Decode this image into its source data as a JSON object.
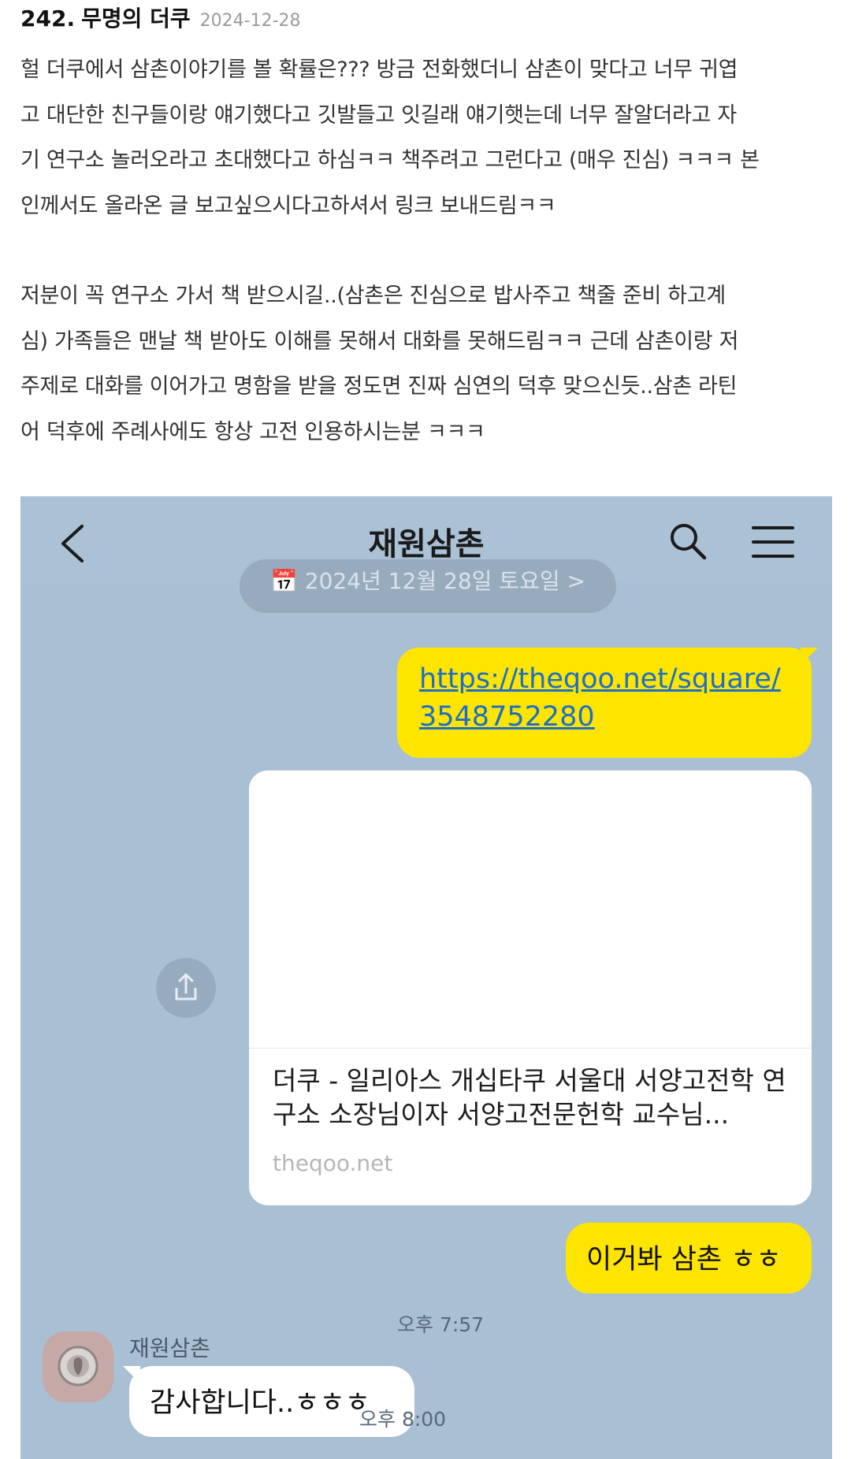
{
  "post": {
    "number": "242.",
    "author": "무명의 더쿠",
    "date": "2024-12-28",
    "paragraphs": [
      "헐 더쿠에서 삼촌이야기를 볼 확률은??? 방금 전화했더니 삼촌이 맞다고 너무 귀엽\n고 대단한 친구들이랑 얘기했다고 깃발들고 잇길래 얘기햇는데 너무 잘알더라고 자\n기 연구소 놀러오라고 초대했다고 하심ㅋㅋ 책주려고 그런다고 (매우 진심) ㅋㅋㅋ 본\n인께서도 올라온 글 보고싶으시다고하셔서 링크 보내드림ㅋㅋ",
      "저분이 꼭 연구소 가서 책 받으시길..(삼촌은 진심으로 밥사주고 책줄 준비 하고계\n심) 가족들은 맨날 책 받아도 이해를 못해서 대화를 못해드림ㅋㅋ 근데 삼촌이랑 저\n주제로 대화를 이어가고 명함을 받을 정도면 진짜 심연의 덕후 맞으신듯..삼촌 라틴\n어 덕후에 주례사에도 항상 고전 인용하시는분 ㅋㅋㅋ"
    ]
  },
  "chat": {
    "title": "재원삼촌",
    "date_divider": "📅 2024년 12월 28일 토요일 >",
    "link_message": "https://theqoo.net/square/3548752280",
    "link_card": {
      "title": "더쿠 - 일리아스 개십타쿠 서울대 서양고전학 연구소 소장님이자 서양고전문헌학 교수님...",
      "domain": "theqoo.net"
    },
    "message2": "이거봐 삼촌 ㅎㅎ",
    "time2": "오후 7:57",
    "sender_name": "재원삼촌",
    "reply": "감사합니다..ㅎㅎㅎ",
    "reply_time": "오후 8:00"
  },
  "colors": {
    "chat_bg": "#a9bfd3",
    "my_bubble": "#fee500",
    "link": "#1d6ecb"
  },
  "icons": [
    "back-arrow-icon",
    "search-icon",
    "hamburger-menu-icon",
    "share-icon",
    "calendar-icon"
  ]
}
